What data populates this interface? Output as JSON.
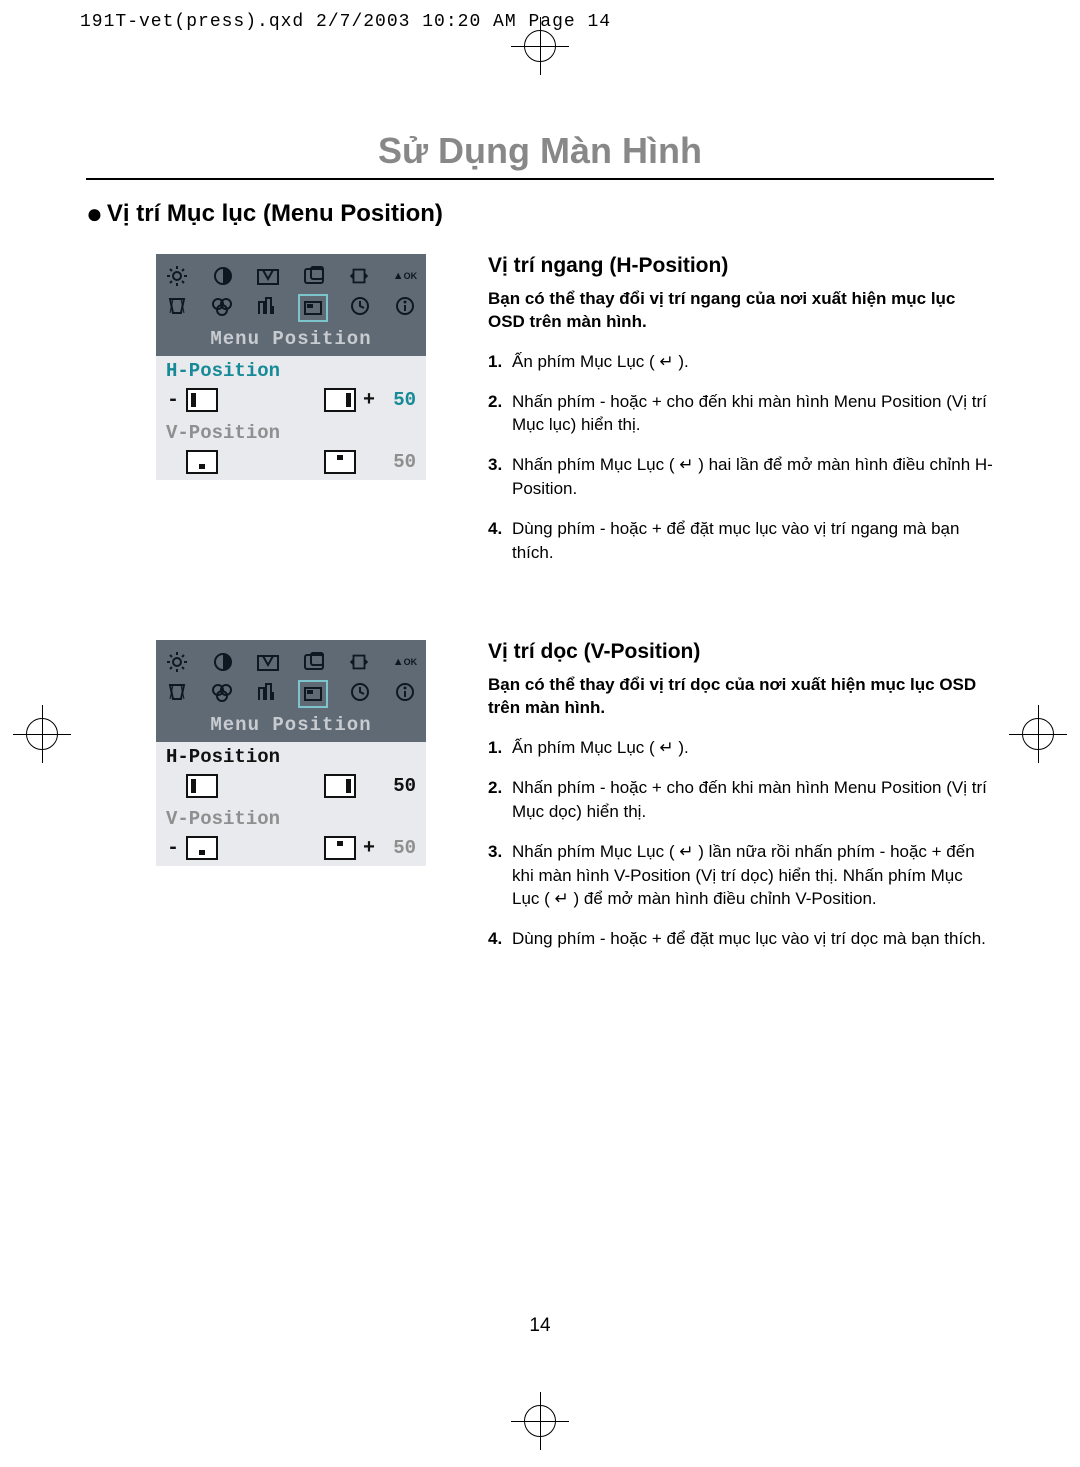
{
  "meta_line": "191T-vet(press).qxd  2/7/2003  10:20 AM  Page 14",
  "page_title": "Sử Dụng Màn Hình",
  "section_title": "Vị trí Mục lục (Menu Position)",
  "page_number": "14",
  "osd": {
    "title": "Menu Position",
    "h_label": "H-Position",
    "v_label": "V-Position",
    "value": "50"
  },
  "hpos": {
    "heading": "Vị trí ngang (H-Position)",
    "lead": "Bạn có thể thay đổi vị trí ngang của nơi xuất hiện mục lục OSD trên màn hình.",
    "steps": [
      "Ấn phím Mục Lục ( ↵ ).",
      "Nhấn phím - hoặc + cho đến khi màn hình Menu Position (Vị trí Mục lục) hiển thị.",
      "Nhấn phím Mục Lục ( ↵ ) hai lần để mở màn hình điều chỉnh H-Position.",
      "Dùng phím - hoặc + để đặt mục lục vào vị trí ngang mà bạn thích."
    ]
  },
  "vpos": {
    "heading": "Vị trí dọc (V-Position)",
    "lead": "Bạn có thể thay đổi vị trí dọc của nơi xuất hiện mục lục OSD trên màn hình.",
    "steps": [
      "Ấn phím Mục Lục ( ↵ ).",
      "Nhấn phím - hoặc + cho đến khi màn hình Menu Position (Vị trí Mục dọc) hiển thị.",
      "Nhấn phím Mục Lục ( ↵ ) lần nữa rồi nhấn phím - hoặc + đến khi màn hình V-Position (Vị trí dọc) hiển thị. Nhấn phím Mục Lục ( ↵ ) để mở màn hình điều chỉnh V-Position.",
      "Dùng phím - hoặc + để đặt mục lục vào vị trí dọc mà bạn thích."
    ]
  }
}
